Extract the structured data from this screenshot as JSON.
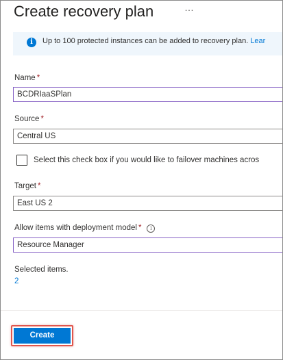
{
  "page": {
    "title": "Create recovery plan",
    "more_icon": "…"
  },
  "info": {
    "icon": "info-icon",
    "text": "Up to 100 protected instances can be added to recovery plan.",
    "link_text": "Lear"
  },
  "form": {
    "required_marker": "*",
    "name": {
      "label": "Name",
      "value": "BCDRIaaSPlan"
    },
    "source": {
      "label": "Source",
      "value": "Central US"
    },
    "failover_checkbox": {
      "label": "Select this check box if you would like to failover machines acros",
      "checked": false
    },
    "target": {
      "label": "Target",
      "value": "East US 2"
    },
    "deployment_model": {
      "label": "Allow items with deployment model",
      "help_icon": "i",
      "value": "Resource Manager"
    },
    "selected_items": {
      "label": "Selected items.",
      "value": "2"
    }
  },
  "footer": {
    "create_label": "Create"
  },
  "colors": {
    "accent": "#0078d4",
    "required": "#a4262c",
    "active_border": "#8661c5",
    "highlight": "#e0564d",
    "info_background": "#eff6fc"
  }
}
